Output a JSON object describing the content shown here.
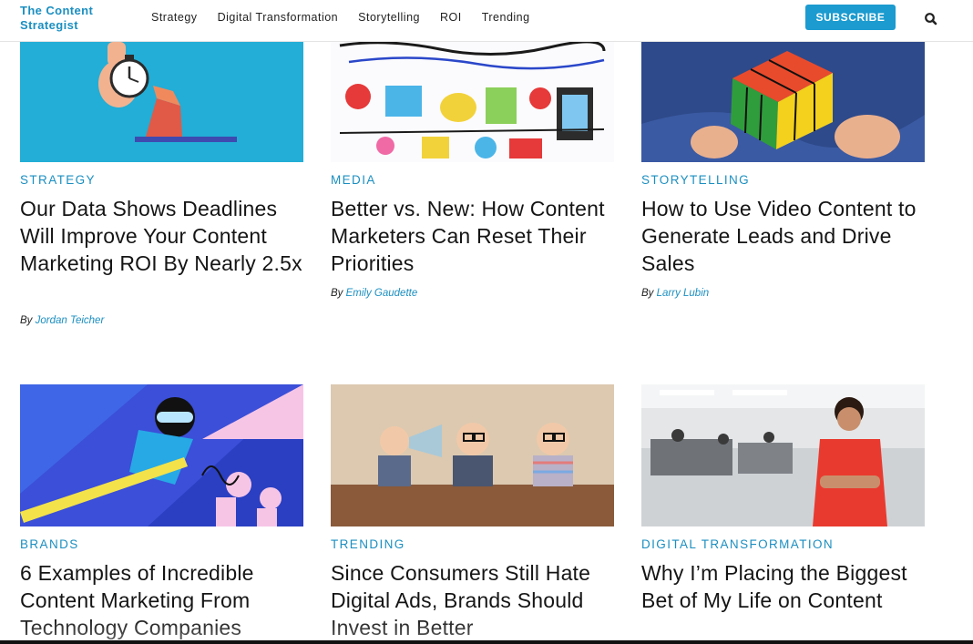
{
  "header": {
    "logo_line1": "The Content",
    "logo_line2": "Strategist",
    "nav": [
      "Strategy",
      "Digital Transformation",
      "Storytelling",
      "ROI",
      "Trending"
    ],
    "subscribe_label": "SUBSCRIBE"
  },
  "byline_prefix": "By",
  "articles": [
    {
      "category": "STRATEGY",
      "title": "Our Data Shows Deadlines Will Improve Your Content Marketing ROI By Nearly 2.5x",
      "author": "Jordan Teicher"
    },
    {
      "category": "MEDIA",
      "title": "Better vs. New: How Content Marketers Can Reset Their Priorities",
      "author": "Emily Gaudette"
    },
    {
      "category": "STORYTELLING",
      "title": "How to Use Video Content to Generate Leads and Drive Sales",
      "author": "Larry Lubin"
    },
    {
      "category": "BRANDS",
      "title": "6 Examples of Incredible Content Marketing From Technology Companies"
    },
    {
      "category": "TRENDING",
      "title": "Since Consumers Still Hate Digital Ads, Brands Should Invest in Better"
    },
    {
      "category": "DIGITAL TRANSFORMATION",
      "title": "Why I’m Placing the Biggest Bet of My Life on Content"
    }
  ],
  "colors": {
    "accent": "#1b8fc1",
    "subscribe_bg": "#1b9bcf"
  },
  "icons": {
    "search": "search-icon"
  }
}
